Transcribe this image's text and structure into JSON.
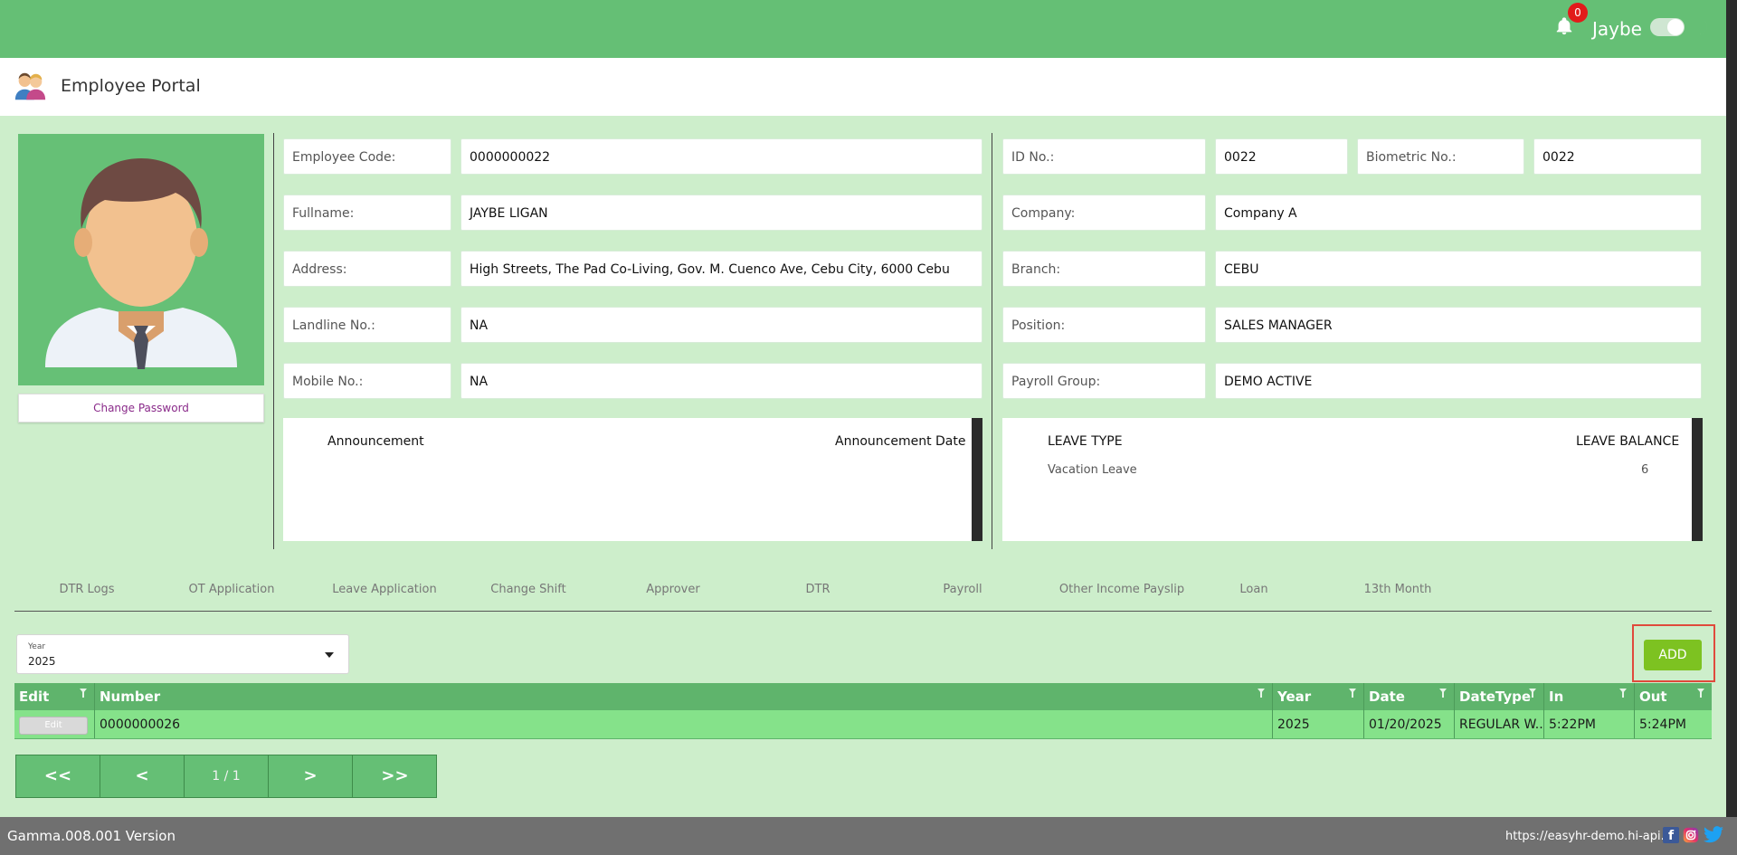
{
  "header": {
    "notification_count": "0",
    "user_name": "Jaybe"
  },
  "app": {
    "title": "Employee Portal"
  },
  "profile": {
    "change_password": "Change Password"
  },
  "fields": {
    "employee_code_label": "Employee Code:",
    "employee_code": "0000000022",
    "fullname_label": "Fullname:",
    "fullname": "JAYBE LIGAN",
    "address_label": "Address:",
    "address": "High Streets, The Pad Co-Living, Gov. M. Cuenco Ave, Cebu City, 6000 Cebu",
    "landline_label": "Landline No.:",
    "landline": "NA",
    "mobile_label": "Mobile No.:",
    "mobile": "NA",
    "id_no_label": "ID No.:",
    "id_no": "0022",
    "biometric_label": "Biometric No.:",
    "biometric": "0022",
    "company_label": "Company:",
    "company": "Company A",
    "branch_label": "Branch:",
    "branch": "CEBU",
    "position_label": "Position:",
    "position": "SALES MANAGER",
    "payroll_group_label": "Payroll Group:",
    "payroll_group": "DEMO ACTIVE"
  },
  "announcements": {
    "col_announcement": "Announcement",
    "col_date": "Announcement Date"
  },
  "leave": {
    "col_type": "LEAVE TYPE",
    "col_balance": "LEAVE BALANCE",
    "rows": [
      {
        "type": "Vacation Leave",
        "balance": "6"
      }
    ]
  },
  "tabs": [
    "DTR Logs",
    "OT Application",
    "Leave Application",
    "Change Shift",
    "Approver",
    "DTR",
    "Payroll",
    "Other Income Payslip",
    "Loan",
    "13th Month"
  ],
  "filter": {
    "year_label": "Year",
    "year_value": "2025"
  },
  "add_button": "ADD",
  "grid": {
    "columns": [
      "Edit",
      "Number",
      "Year",
      "Date",
      "DateType",
      "In",
      "Out"
    ],
    "rows": [
      {
        "edit": "Edit",
        "number": "0000000026",
        "year": "2025",
        "date": "01/20/2025",
        "datetype": "REGULAR W...",
        "in": "5:22PM",
        "out": "5:24PM"
      }
    ]
  },
  "pager": {
    "first": "<<",
    "prev": "<",
    "info": "1 / 1",
    "next": ">",
    "last": ">>"
  },
  "footer": {
    "version": "Gamma.008.001 Version",
    "url": "https://easyhr-demo.hi-api.io"
  },
  "colors": {
    "primary_green": "#65bf75",
    "background": "#cdeecb",
    "row_green": "#85e28a",
    "add_button": "#7dc221",
    "badge_red": "#e21b1b"
  }
}
